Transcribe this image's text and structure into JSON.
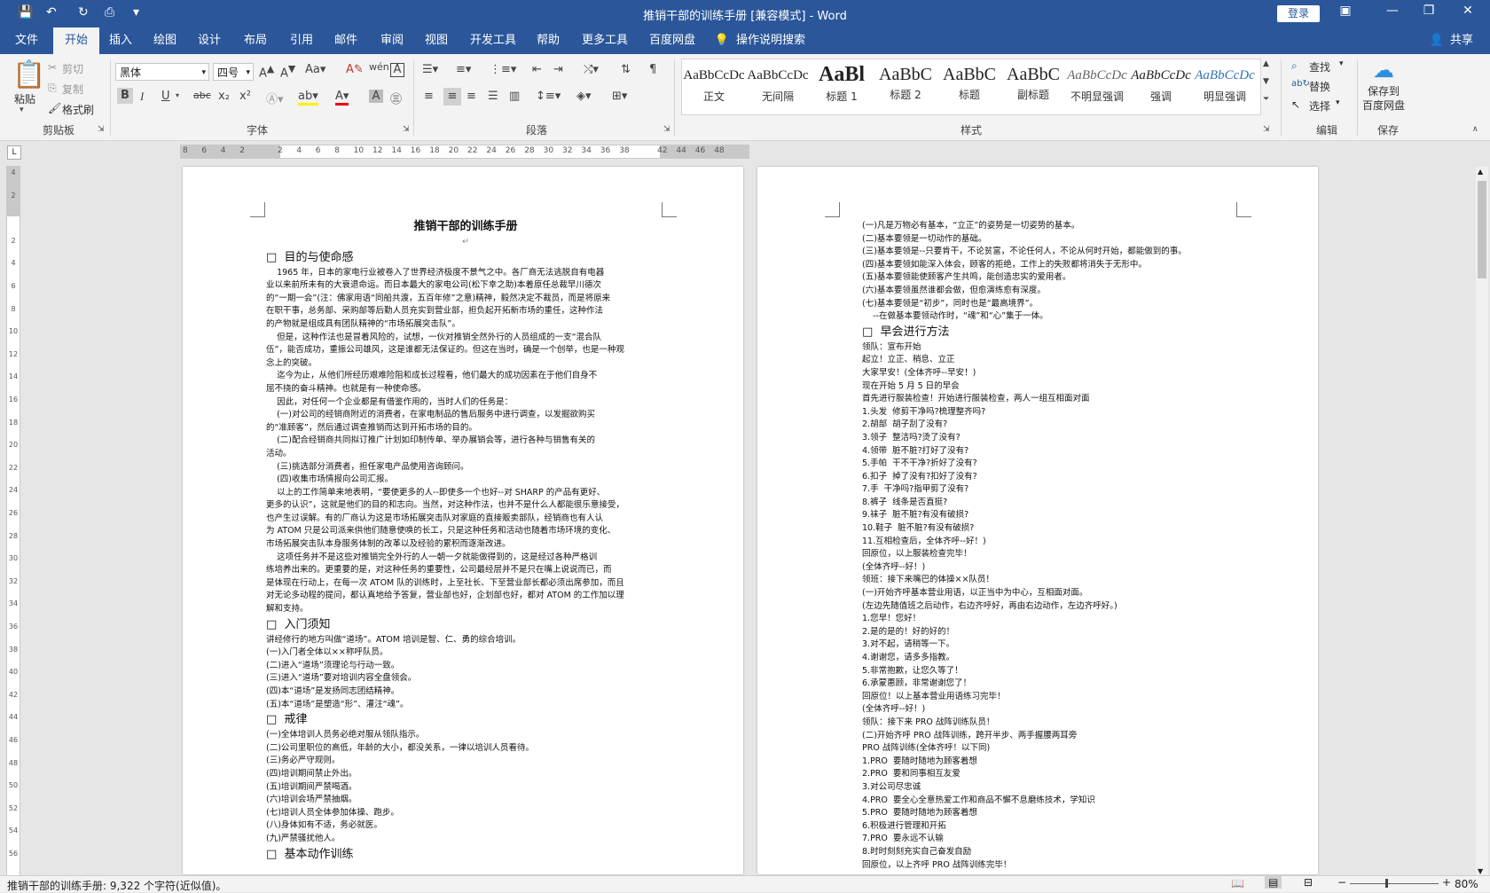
{
  "window": {
    "title": "推销干部的训练手册 [兼容模式] - Word",
    "login_label": "登录",
    "share_label": "共享"
  },
  "menu": {
    "tabs": [
      "文件",
      "开始",
      "插入",
      "绘图",
      "设计",
      "布局",
      "引用",
      "邮件",
      "审阅",
      "视图",
      "开发工具",
      "帮助",
      "更多工具",
      "百度网盘"
    ],
    "active": "开始",
    "tell_me": "操作说明搜索"
  },
  "ribbon": {
    "clipboard": {
      "paste": "粘贴",
      "cut": "剪切",
      "copy": "复制",
      "format_painter": "格式刷",
      "label": "剪贴板"
    },
    "font": {
      "name": "黑体",
      "size": "四号",
      "label": "字体"
    },
    "paragraph": {
      "label": "段落"
    },
    "styles": {
      "label": "样式",
      "items": [
        {
          "sample": "AaBbCcDc",
          "name": "正文"
        },
        {
          "sample": "AaBbCcDc",
          "name": "无间隔"
        },
        {
          "sample": "AaBl",
          "name": "标题 1"
        },
        {
          "sample": "AaBbC",
          "name": "标题 2"
        },
        {
          "sample": "AaBbC",
          "name": "标题"
        },
        {
          "sample": "AaBbC",
          "name": "副标题"
        },
        {
          "sample": "AaBbCcDc",
          "name": "不明显强调"
        },
        {
          "sample": "AaBbCcDc",
          "name": "强调"
        },
        {
          "sample": "AaBbCcDc",
          "name": "明显强调"
        }
      ]
    },
    "editing": {
      "find": "查找",
      "replace": "替换",
      "select": "选择",
      "label": "编辑"
    },
    "save": {
      "button": "保存到\n百度网盘",
      "label": "保存"
    }
  },
  "ruler": {
    "ticks": [
      "8",
      "6",
      "4",
      "2",
      "",
      "2",
      "4",
      "6",
      "8",
      "10",
      "12",
      "14",
      "16",
      "18",
      "20",
      "22",
      "24",
      "26",
      "28",
      "30",
      "32",
      "34",
      "36",
      "38",
      "",
      "42",
      "44",
      "46",
      "48"
    ]
  },
  "vruler": {
    "ticks": [
      "4",
      "2",
      "",
      "2",
      "4",
      "6",
      "8",
      "10",
      "12",
      "14",
      "16",
      "18",
      "20",
      "22",
      "24",
      "26",
      "28",
      "30",
      "32",
      "34",
      "36",
      "38",
      "40",
      "42",
      "44",
      "46",
      "48",
      "50",
      "52",
      "54",
      "56"
    ]
  },
  "page1": {
    "title": "推销干部的训练手册",
    "lines": [
      {
        "t": "□  目的与使命感",
        "h": 1
      },
      {
        "t": "    1965 年，日本的家电行业被卷入了世界经济极度不景气之中。各厂商无法逃脱自有电器"
      },
      {
        "t": "业以来前所未有的大衰退命运。而日本最大的家电公司(松下幸之助)本着原任总裁早川德次"
      },
      {
        "t": "的“一期一会”(注：佛家用语“同船共渡，五百年修”之意)精神，毅然决定不裁员，而是将原来"
      },
      {
        "t": "在职干事，总务部、采购部等后勤人员充实到营业部，担负起开拓新市场的重任，这种作法"
      },
      {
        "t": "的产物就是组成具有团队精神的“市场拓展突击队”。"
      },
      {
        "t": "    但是，这种作法也是冒着风险的，试想，一伙对推销全然外行的人员组成的一支“混合队"
      },
      {
        "t": "伍”，能否成功，重振公司雄风，这是谁都无法保证的。但这在当时，确是一个创举，也是一种观"
      },
      {
        "t": "念上的突破。"
      },
      {
        "t": "    迄今为止，从他们所经历艰难险阻和成长过程看，他们最大的成功因素在于他们自身不"
      },
      {
        "t": "屈不挠的奋斗精神。也就是有一种使命感。"
      },
      {
        "t": "    因此，对任何一个企业都是有借鉴作用的，当时人们的任务是："
      },
      {
        "t": "    (一)对公司的经销商附近的消费者，在家电制品的售后服务中进行调查，以发掘欲购买"
      },
      {
        "t": "的“准顾客”，然后通过调查推销而达到开拓市场的目的。"
      },
      {
        "t": "    (二)配合经销商共同拟订推广计划如印制传单、举办展销会等，进行各种与销售有关的"
      },
      {
        "t": "活动。"
      },
      {
        "t": "    (三)挑选部分消费者，担任家电产品使用咨询顾问。"
      },
      {
        "t": "    (四)收集市场情报向公司汇报。"
      },
      {
        "t": "    以上的工作简单来地表明，“要使更多的人--即使多一个也好--对 SHARP 的产品有更好、"
      },
      {
        "t": "更多的认识”，这就是他们的目的和志向。当然，对这种作法，也并不是什么人都能很乐意接受，"
      },
      {
        "t": "也产生过误解。有的厂商认为这是市场拓展突击队对家庭的直接贩卖部队，经销商也有人认"
      },
      {
        "t": "为 ATOM 只是公司派来供他们随意使唤的长工，只是这种任务和活动也随着市场环境的变化、"
      },
      {
        "t": "市场拓展突击队本身服务体制的改革以及经验的累积而逐渐改进。"
      },
      {
        "t": "    这项任务并不是这些对推销完全外行的人一朝一夕就能做得到的，这是经过各种严格训"
      },
      {
        "t": "练培养出来的。更重要的是，对这种任务的重要性，公司最经层并不是只在嘴上说说而已，而"
      },
      {
        "t": "是体现在行动上，在每一次 ATOM 队的训练时，上至社长、下至营业部长都必须出席参加，而且"
      },
      {
        "t": "对无论多动程的提问，都认真地给予答复，营业部也好，企划部也好，都对 ATOM 的工作加以理"
      },
      {
        "t": "解和支持。"
      },
      {
        "t": "□  入门须知",
        "h": 1
      },
      {
        "t": "讲经修行的地方叫做“道场”。ATOM 培训是智、仁、勇的综合培训。"
      },
      {
        "t": "(一)入门者全体以××称呼队员。"
      },
      {
        "t": "(二)进入“道场”须理论与行动一致。"
      },
      {
        "t": "(三)进入“道场”要对培训内容全盘领会。"
      },
      {
        "t": "(四)本“道场”是发扬同志团结精神。"
      },
      {
        "t": "(五)本“道场”是塑造“形”、灌注“魂”。"
      },
      {
        "t": "□  戒律",
        "h": 1
      },
      {
        "t": "(一)全体培训人员务必绝对服从领队指示。"
      },
      {
        "t": "(二)公司里职位的高低，年龄的大小，都没关系，一律以培训人员看待。"
      },
      {
        "t": "(三)务必严守规则。"
      },
      {
        "t": "(四)培训期间禁止外出。"
      },
      {
        "t": "(五)培训期间严禁喝酒。"
      },
      {
        "t": "(六)培训会场严禁抽烟。"
      },
      {
        "t": "(七)培训人员全体参加体操、跑步。"
      },
      {
        "t": "(八)身体如有不适，务必就医。"
      },
      {
        "t": "(九)严禁骚扰他人。"
      },
      {
        "t": "□  基本动作训练",
        "h": 1
      }
    ]
  },
  "page2": {
    "lines": [
      {
        "t": "(一)凡是万物必有基本，“立正”的姿势是一切姿势的基本。"
      },
      {
        "t": "(二)基本要领是一切动作的基础。"
      },
      {
        "t": "(三)基本要领是--只要肯干，不论贫富，不论任何人，不论从何时开始，都能做到的事。"
      },
      {
        "t": "(四)基本要领如能深入体会，顾客的拒绝，工作上的失败都将消失于无形中。"
      },
      {
        "t": "(五)基本要领能使顾客产生共鸣，能创造忠实的爱用者。"
      },
      {
        "t": "(六)基本要领虽然谁都会做，但愈演练愈有深度。"
      },
      {
        "t": "(七)基本要领是“初步”，同时也是“最高境界”。"
      },
      {
        "t": "    --在做基本要领动作时，“魂”和“心”集于一体。"
      },
      {
        "t": "□  早会进行方法",
        "h": 1
      },
      {
        "t": "领队：宣布开始"
      },
      {
        "t": "起立！立正、稍息、立正"
      },
      {
        "t": "大家早安！(全体齐呼--早安！)"
      },
      {
        "t": "现在开始 5 月 5 日的早会"
      },
      {
        "t": "首先进行服装检查！开始进行服装检查，两人一组互相面对面"
      },
      {
        "t": "1.头发  修剪干净吗?梳理整齐吗?"
      },
      {
        "t": "2.胡部  胡子刮了没有?"
      },
      {
        "t": "3.领子  整洁吗?烫了没有?"
      },
      {
        "t": "4.领带  脏不脏?打好了没有?"
      },
      {
        "t": "5.手帕  干不干净?折好了没有?"
      },
      {
        "t": "6.扣子  掉了没有?扣好了没有?"
      },
      {
        "t": "7.手  干净吗?指甲剪了没有?"
      },
      {
        "t": "8.裤子  线条是否直挺?"
      },
      {
        "t": "9.袜子  脏不脏?有没有破损?"
      },
      {
        "t": "10.鞋子  脏不脏?有没有破损?"
      },
      {
        "t": "11.互相检查后，全体齐呼--好！)"
      },
      {
        "t": "回原位，以上服装检查完毕！"
      },
      {
        "t": "(全体齐呼--好！)"
      },
      {
        "t": "领班：接下来嘴巴的体操××队员！"
      },
      {
        "t": "(一)开始齐呼基本营业用语，以正当中为中心，互相面对面。"
      },
      {
        "t": "(左边先随值班之后动作，右边齐呼好，再由右边动作，左边齐呼好。)"
      },
      {
        "t": "1.您早！您好！"
      },
      {
        "t": "2.是的是的！好的好的！"
      },
      {
        "t": "3.对不起，请稍等一下。"
      },
      {
        "t": "4.谢谢您，请多多指教。"
      },
      {
        "t": "5.非常抱歉，让您久等了！"
      },
      {
        "t": "6.承蒙惠顾，非常谢谢您了！"
      },
      {
        "t": "回原位！以上基本营业用语练习完毕！"
      },
      {
        "t": "(全体齐呼--好！)"
      },
      {
        "t": "领队：接下来 PRO 战阵训练队员！"
      },
      {
        "t": "(二)开始齐呼 PRO 战阵训练，跨开半步、两手握腰两耳旁"
      },
      {
        "t": "PRO 战阵训练(全体齐呼！以下同)"
      },
      {
        "t": "1.PRO  要随时随地为顾客着想"
      },
      {
        "t": "2.PRO  要和同事相互友爱"
      },
      {
        "t": "3.对公司尽忠诚"
      },
      {
        "t": "4.PRO  要全心全意热爱工作和商品不懈不息磨练技术，学知识"
      },
      {
        "t": "5.PRO  要随时随地为顾客着想"
      },
      {
        "t": "6.积极进行管理和开拓"
      },
      {
        "t": "7.PRO  要永远不认输"
      },
      {
        "t": "8.时时刻刻充实自己奋发自励"
      },
      {
        "t": "回原位，以上齐呼 PRO 战阵训练完毕！"
      }
    ]
  },
  "status": {
    "words": "推销干部的训练手册: 9,322 个字符(近似值)。",
    "zoom": "80%"
  }
}
